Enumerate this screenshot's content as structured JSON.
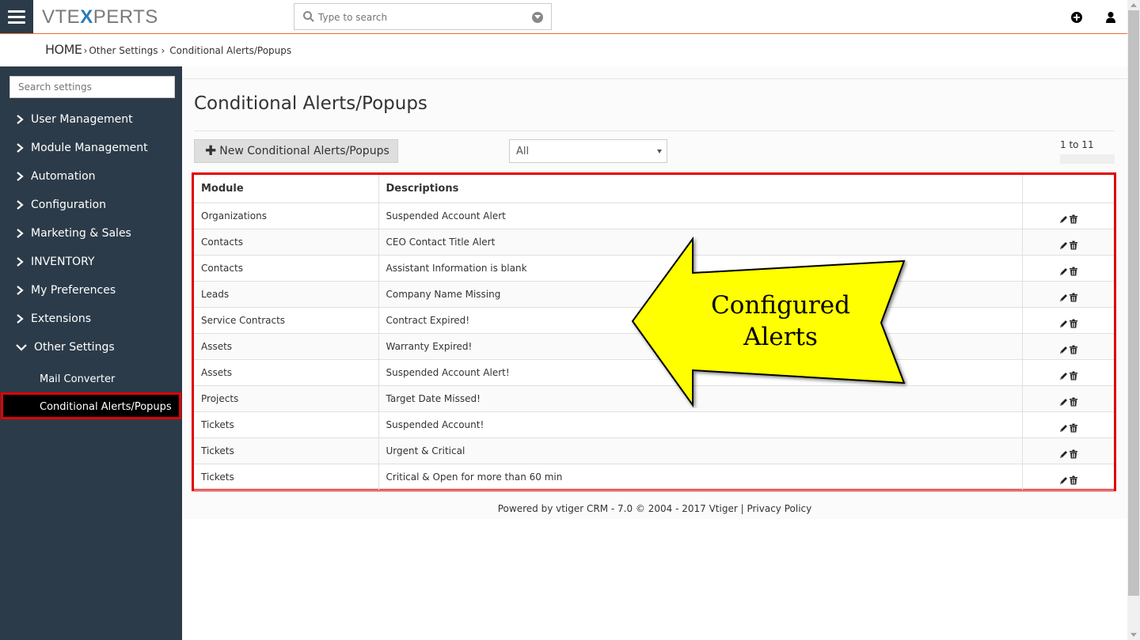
{
  "header": {
    "logo_prefix": "VTE",
    "logo_x": "X",
    "logo_suffix": "PERTS",
    "search_placeholder": "Type to search",
    "add_icon": "plus-circle-icon",
    "user_icon": "user-icon"
  },
  "breadcrumb": {
    "home": "HOME",
    "level1": "Other Settings",
    "level2": "Conditional Alerts/Popups"
  },
  "sidebar": {
    "search_placeholder": "Search settings",
    "items": [
      {
        "label": "User Management"
      },
      {
        "label": "Module Management"
      },
      {
        "label": "Automation"
      },
      {
        "label": "Configuration"
      },
      {
        "label": "Marketing & Sales"
      },
      {
        "label": "INVENTORY"
      },
      {
        "label": "My Preferences"
      },
      {
        "label": "Extensions"
      },
      {
        "label": "Other Settings"
      }
    ],
    "subitems": [
      {
        "label": "Mail Converter"
      },
      {
        "label": "Conditional Alerts/Popups"
      }
    ]
  },
  "main": {
    "title": "Conditional Alerts/Popups",
    "new_button": "New Conditional Alerts/Popups",
    "filter_value": "All",
    "paging": "1 to 11",
    "columns": [
      "Module",
      "Descriptions",
      ""
    ],
    "rows": [
      {
        "module": "Organizations",
        "description": "Suspended Account Alert"
      },
      {
        "module": "Contacts",
        "description": "CEO Contact Title Alert"
      },
      {
        "module": "Contacts",
        "description": "Assistant Information is blank"
      },
      {
        "module": "Leads",
        "description": "Company Name Missing"
      },
      {
        "module": "Service Contracts",
        "description": "Contract Expired!"
      },
      {
        "module": "Assets",
        "description": "Warranty Expired!"
      },
      {
        "module": "Assets",
        "description": "Suspended Account Alert!"
      },
      {
        "module": "Projects",
        "description": "Target Date Missed!"
      },
      {
        "module": "Tickets",
        "description": "Suspended Account!"
      },
      {
        "module": "Tickets",
        "description": "Urgent & Critical"
      },
      {
        "module": "Tickets",
        "description": "Critical & Open for more than 60 min"
      }
    ],
    "row_icons": [
      "pencil-icon",
      "trash-icon"
    ]
  },
  "callout": {
    "line1": "Configured",
    "line2": "Alerts",
    "fill": "#ffff00"
  },
  "footer": {
    "text": "Powered by vtiger CRM - 7.0  © 2004 - 2017  Vtiger |  Privacy Policy"
  },
  "colors": {
    "sidebar_bg": "#2c3b49",
    "highlight": "#e00000",
    "header_accent": "#f26a2e",
    "logo_accent": "#2b7bb9"
  }
}
